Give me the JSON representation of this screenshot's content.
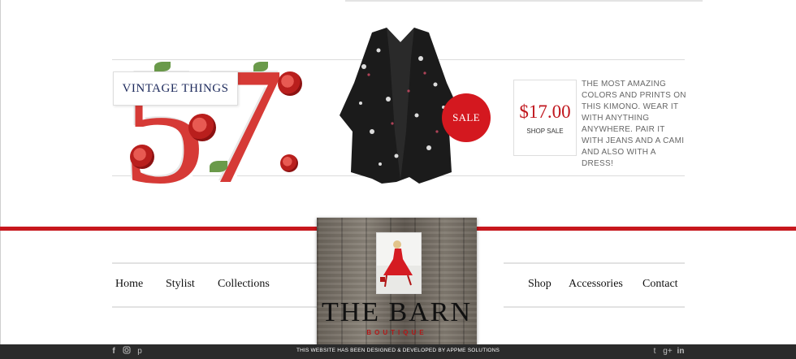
{
  "product": {
    "big_number": "57",
    "badge": "VINTAGE THINGS",
    "sale_label": "SALE",
    "price": "$17.00",
    "shop_link": "SHOP SALE",
    "description": "THE MOST AMAZING COLORS AND PRINTS ON THIS KIMONO. WEAR IT WITH ANYTHING ANYWHERE. PAIR IT WITH JEANS AND A CAMI AND ALSO WITH A DRESS!"
  },
  "nav": {
    "left": [
      "Home",
      "Stylist",
      "Collections"
    ],
    "right": [
      "Shop",
      "Accessories",
      "Contact"
    ]
  },
  "logo": {
    "title": "THE BARN",
    "subtitle": "BOUTIQUE"
  },
  "footer": {
    "credit": "THIS WEBSITE HAS BEEN DESIGNED & DEVELOPED BY APPME SOLUTIONS",
    "social_left": [
      "facebook-icon",
      "instagram-icon",
      "pinterest-icon"
    ],
    "social_right": [
      "twitter-icon",
      "google-plus-icon",
      "linkedin-icon"
    ]
  },
  "colors": {
    "accent_red": "#c7171d",
    "badge_text": "#1d2a5c",
    "footer_bg": "#2b2b2b"
  }
}
